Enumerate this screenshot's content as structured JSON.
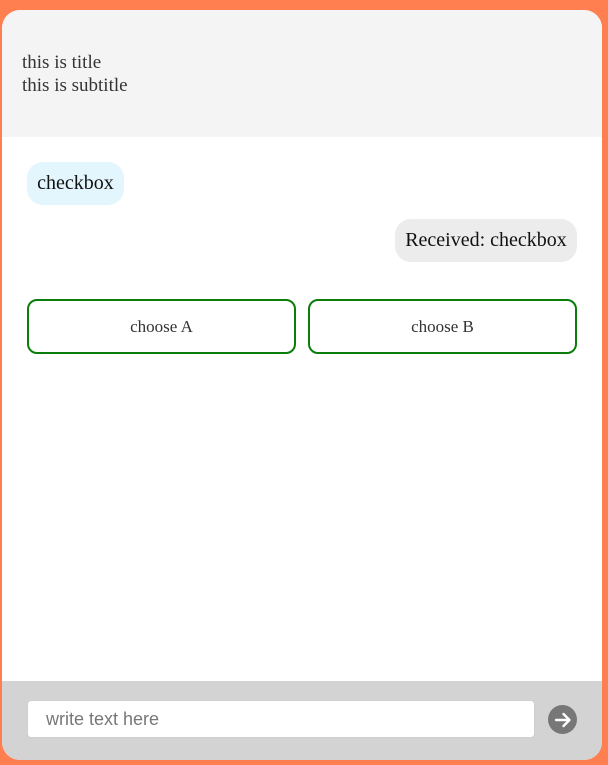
{
  "header": {
    "title": "this is title",
    "subtitle": "this is subtitle"
  },
  "messages": [
    {
      "from": "bot",
      "text": "checkbox"
    },
    {
      "from": "user",
      "text": "Received: checkbox"
    }
  ],
  "choices": [
    {
      "label": "choose A"
    },
    {
      "label": "choose B"
    }
  ],
  "composer": {
    "placeholder": "write text here",
    "send_icon": "arrow-right-circle-icon"
  },
  "colors": {
    "frame": "#ff7f50",
    "header_bg": "#f4f4f4",
    "bot_bubble": "#e4f6fd",
    "user_bubble": "#ececec",
    "choice_border": "#0a7d0a",
    "footer_bg": "#d3d3d3",
    "send_button": "#777777"
  }
}
